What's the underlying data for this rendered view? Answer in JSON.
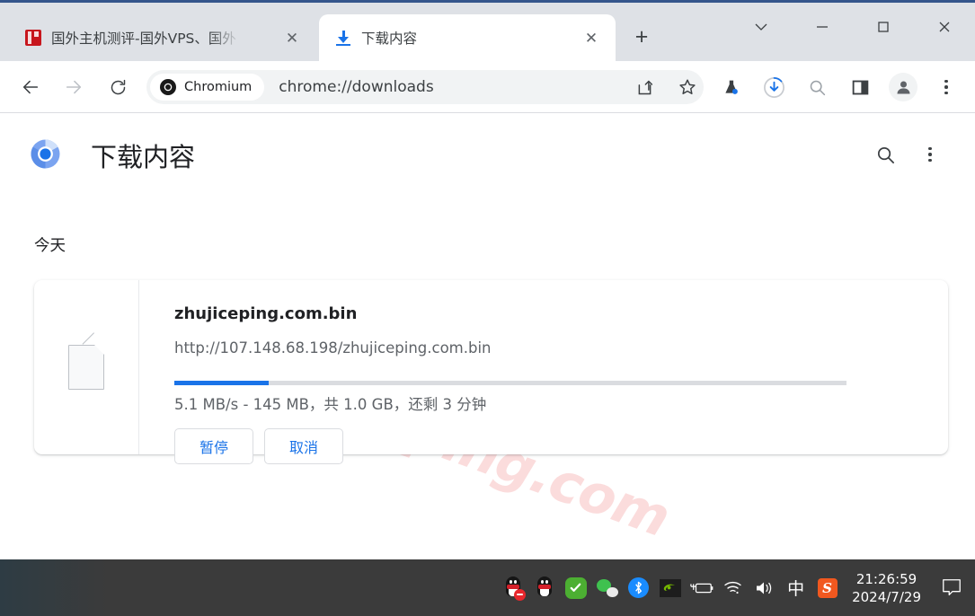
{
  "window": {
    "controls": {
      "tab_search": "tab-search-chevron",
      "minimize": "minimize",
      "maximize": "maximize",
      "close": "close"
    }
  },
  "tabs": [
    {
      "title": "国外主机测评-国外VPS、国外",
      "active": false,
      "favicon": "red-site-favicon",
      "close_label": "✕"
    },
    {
      "title": "下载内容",
      "active": true,
      "favicon": "download-icon",
      "close_label": "✕"
    }
  ],
  "newtab_label": "+",
  "toolbar": {
    "back": "back-arrow",
    "forward": "forward-arrow",
    "reload": "reload",
    "omnibox": {
      "chip_label": "Chromium",
      "url": "chrome://downloads"
    },
    "icons": [
      "share-icon",
      "bookmark-star-icon",
      "experiments-flask-icon",
      "downloads-progress-icon",
      "search-icon",
      "side-panel-icon",
      "profile-avatar-icon",
      "browser-menu-icon"
    ]
  },
  "page": {
    "title": "下载内容",
    "logo": "chromium-logo",
    "search_icon": "search-icon",
    "menu_icon": "more-vert-icon",
    "watermark": "zhujiceping.com",
    "date_group": "今天",
    "download": {
      "file_icon": "generic-file-icon",
      "filename": "zhujiceping.com.bin",
      "url": "http://107.148.68.198/zhujiceping.com.bin",
      "status": "5.1 MB/s - 145 MB，共 1.0 GB，还剩 3 分钟",
      "progress_percent": 14,
      "pause_label": "暂停",
      "cancel_label": "取消"
    }
  },
  "taskbar": {
    "tray_icons": [
      "qq-penguin-busy-icon",
      "qq-penguin-icon",
      "security-shield-icon",
      "wechat-icon",
      "bluetooth-icon",
      "nvidia-icon",
      "battery-charging-icon",
      "wifi-icon",
      "volume-icon",
      "ime-chinese-icon",
      "sogou-input-icon"
    ],
    "ime_label": "中",
    "sogou_label": "S",
    "time": "21:26:59",
    "date": "2024/7/29",
    "notification_icon": "notification-icon"
  },
  "colors": {
    "accent_blue": "#1a73e8",
    "tabstrip_bg": "#dee1e6",
    "taskbar_bg": "#3b3b3b",
    "watermark_pink": "#fbdcdc"
  }
}
